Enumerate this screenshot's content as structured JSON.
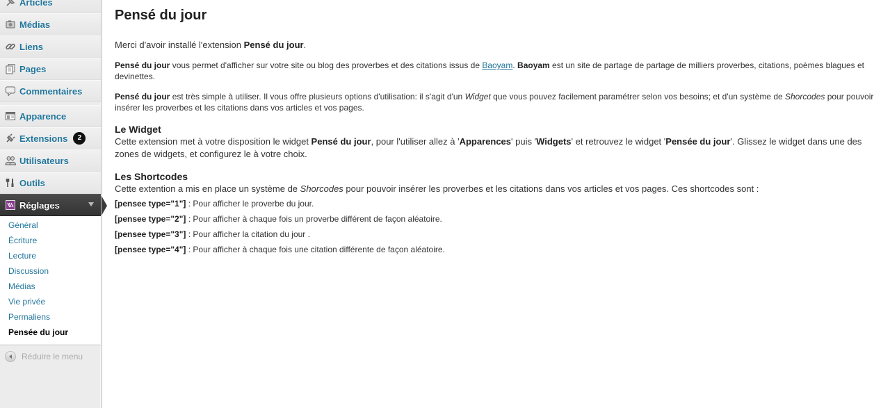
{
  "sidebar": {
    "items": [
      {
        "label": "Articles",
        "icon": "pin-icon"
      },
      {
        "label": "Médias",
        "icon": "media-icon"
      },
      {
        "label": "Liens",
        "icon": "link-icon"
      },
      {
        "label": "Pages",
        "icon": "pages-icon"
      },
      {
        "label": "Commentaires",
        "icon": "comment-icon"
      },
      {
        "label": "Apparence",
        "icon": "appearance-icon"
      },
      {
        "label": "Extensions",
        "icon": "plugin-icon",
        "badge": "2"
      },
      {
        "label": "Utilisateurs",
        "icon": "users-icon"
      },
      {
        "label": "Outils",
        "icon": "tools-icon"
      },
      {
        "label": "Réglages",
        "icon": "settings-icon"
      }
    ],
    "submenu": [
      "Général",
      "Écriture",
      "Lecture",
      "Discussion",
      "Médias",
      "Vie privée",
      "Permaliens",
      "Pensée du jour"
    ],
    "collapse_label": "Réduire le menu"
  },
  "page": {
    "title": "Pensé du jour",
    "intro_prefix": "Merci d'avoir installé l'extension ",
    "intro_bold": "Pensé du jour",
    "intro_suffix": ".",
    "p1": {
      "b1": "Pensé du jour",
      "t1": " vous permet d'afficher sur votre site ou blog des proverbes et des citations issus de ",
      "link": "Baoyam",
      "t2": ". ",
      "b2": "Baoyam",
      "t3": " est un site de partage de partage de milliers proverbes, citations, poèmes blagues et devinettes."
    },
    "p2": {
      "b1": "Pensé du jour",
      "t1": " est très simple à utiliser. Il vous offre plusieurs options d'utilisation: il s'agit d'un ",
      "i1": "Widget",
      "t2": " que vous pouvez facilement paramétrer selon vos besoins; et d'un système de ",
      "i2": "Shorcodes",
      "t3": " pour pouvoir insérer les proverbes et les citations dans vos articles et vos pages."
    },
    "widget": {
      "heading": "Le Widget",
      "t1": "Cette extension met à votre disposition le widget ",
      "b1": "Pensé du jour",
      "t2": ", pour l'utiliser allez à '",
      "b2": "Apparences",
      "t3": "' puis '",
      "b3": "Widgets",
      "t4": "' et retrouvez le widget '",
      "b4": "Pensée du jour",
      "t5": "'. Glissez le widget dans une des zones de widgets, et configurez le à votre choix."
    },
    "shortcodes": {
      "heading": "Les Shortcodes",
      "t1": "Cette extention a mis en place un système de ",
      "i1": "Shorcodes",
      "t2": " pour pouvoir insérer les proverbes et les citations dans vos articles et vos pages. Ces shortcodes sont :",
      "items": [
        {
          "code": "[pensee type=\"1\"]",
          "desc": " : Pour afficher le proverbe du jour."
        },
        {
          "code": "[pensee type=\"2\"]",
          "desc": " : Pour afficher à chaque fois un proverbe différent de façon aléatoire."
        },
        {
          "code": "[pensee type=\"3\"]",
          "desc": " : Pour afficher la citation du jour ."
        },
        {
          "code": "[pensee type=\"4\"]",
          "desc": " : Pour afficher à chaque fois une citation différente de façon aléatoire."
        }
      ]
    }
  }
}
